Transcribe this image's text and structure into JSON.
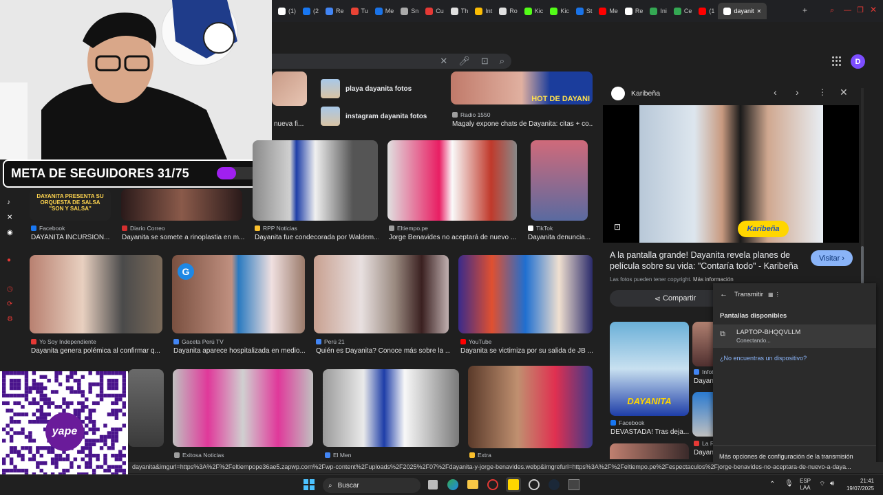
{
  "overlay": {
    "meta_label": "META DE SEGUIDORES 31/75",
    "meta_progress": 0.41,
    "qr_brand": "yape"
  },
  "tabs": [
    {
      "label": "(1)",
      "color": "#ffffff"
    },
    {
      "label": "(2",
      "color": "#1877f2"
    },
    {
      "label": "Re",
      "color": "#4285f4"
    },
    {
      "label": "Tu",
      "color": "#ea4335"
    },
    {
      "label": "Me",
      "color": "#1a73e8"
    },
    {
      "label": "Sn",
      "color": "#aaaaaa"
    },
    {
      "label": "Cu",
      "color": "#e53935"
    },
    {
      "label": "Th",
      "color": "#e0e0e0"
    },
    {
      "label": "Int",
      "color": "#fbbc04"
    },
    {
      "label": "Ro",
      "color": "#e0e0e0"
    },
    {
      "label": "Kic",
      "color": "#53fc18"
    },
    {
      "label": "Kic",
      "color": "#53fc18"
    },
    {
      "label": "St",
      "color": "#1a73e8"
    },
    {
      "label": "Me",
      "color": "#ff0000"
    },
    {
      "label": "Re",
      "color": "#ffffff"
    },
    {
      "label": "Ini",
      "color": "#34a853"
    },
    {
      "label": "Ce",
      "color": "#34a853"
    },
    {
      "label": "(1",
      "color": "#ff0000"
    },
    {
      "label": "dayanit",
      "color": "#ffffff",
      "active": true
    }
  ],
  "new_tab": "+",
  "account_initial": "D",
  "related": [
    {
      "label": "playa dayanita fotos"
    },
    {
      "label": "instagram dayanita fotos"
    }
  ],
  "top_partial": {
    "left_caption": "nueva fi...",
    "source": "Radio 1550",
    "title": "Magaly expone chats de Dayanita: citas + co...",
    "banner": "HOT DE DAYANI"
  },
  "row1": [
    {
      "source": "Facebook",
      "title": "DAYANITA INCURSION...",
      "fav": "#1877f2",
      "overlay": "DAYANITA PRESENTA SU ORQUESTA DE SALSA \"SON Y SALSA\""
    },
    {
      "source": "Diario Correo",
      "title": "Dayanita se somete a rinoplastia en m...",
      "fav": "#d32f2f"
    },
    {
      "source": "RPP Noticias",
      "title": "Dayanita fue condecorada por Waldem...",
      "fav": "#fbc02d"
    },
    {
      "source": "Eltiempo.pe",
      "title": "Jorge Benavides no aceptará de nuevo ...",
      "fav": "#9e9e9e"
    },
    {
      "source": "TikTok",
      "title": "Dayanita denuncia...",
      "fav": "#ffffff"
    }
  ],
  "row2": [
    {
      "source": "Yo Soy Independiente",
      "title": "Dayanita genera polémica al confirmar q...",
      "fav": "#e53935"
    },
    {
      "source": "Gaceta Perú TV",
      "title": "Dayanita aparece hospitalizada en medio...",
      "fav": "#4285f4"
    },
    {
      "source": "Perú 21",
      "title": "Quién es Dayanita? Conoce más sobre la ...",
      "fav": "#4285f4"
    },
    {
      "source": "YouTube",
      "title": "Dayanita se victimiza por su salida de JB ...",
      "fav": "#ff0000"
    }
  ],
  "row3": [
    {
      "source": "Exitosa Noticias",
      "title": "",
      "fav": "#9e9e9e"
    },
    {
      "source": "El Men",
      "title": "",
      "fav": "#4285f4"
    },
    {
      "source": "Extra",
      "title": "",
      "fav": "#fbc02d"
    }
  ],
  "panel": {
    "site": "Karibeña",
    "title": "A la pantalla grande! Dayanita revela planes de película sobre su vida: \"Contaría todo\" - Karibeña",
    "visit": "Visitar",
    "copyright": "Las fotos pueden tener copyright.",
    "more_info": "Más información",
    "share": "Compartir",
    "logo_text": "Karibeña",
    "card1_source": "Facebook",
    "card1_title": "DEVASTADA! Tras deja...",
    "card1_banner": "DAYANITA",
    "card2_source": "Infob",
    "card2_title": "Dayan",
    "card3_source": "La R",
    "card3_title": "Dayan"
  },
  "cast": {
    "title": "Transmitir",
    "section": "Pantallas disponibles",
    "device": "LAPTOP-BHQQVLLM",
    "device_status": "Conectando...",
    "not_found": "¿No encuentras un dispositivo?",
    "more": "Más opciones de configuración de la transmisión"
  },
  "status_url": "dayanita&imgurl=https%3A%2F%2Feltiempope36ae5.zapwp.com%2Fwp-content%2Fuploads%2F2025%2F07%2Fdayanita-y-jorge-benavides.webp&imgrefurl=https%3A%2F%2Feltiempo.pe%2Fespectaculos%2Fjorge-benavides-no-aceptara-de-nuevo-a-daya...",
  "taskbar": {
    "search": "Buscar",
    "lang1": "ESP",
    "lang2": "LAA",
    "time": "21:41",
    "date": "19/07/2025"
  }
}
